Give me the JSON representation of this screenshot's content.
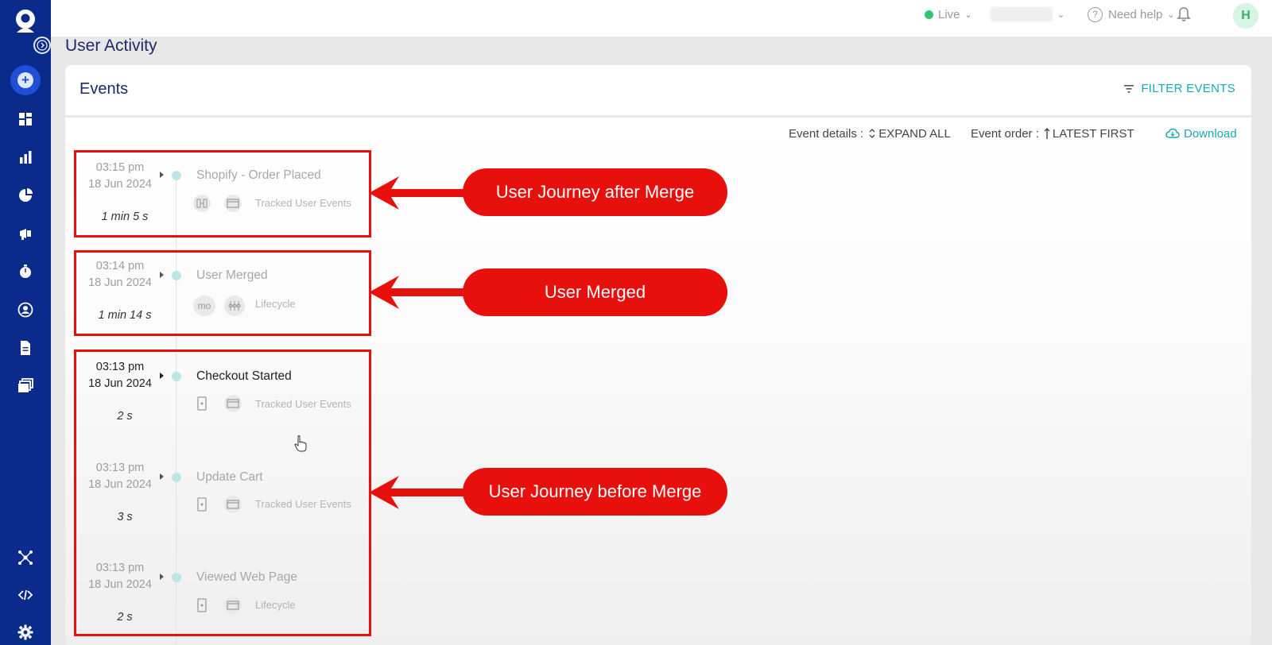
{
  "topbar": {
    "live_label": "Live",
    "need_help_label": "Need help",
    "avatar_initial": "H"
  },
  "page_title": "User Activity",
  "card": {
    "title": "Events",
    "filter_label": "FILTER EVENTS",
    "event_details_label": "Event details :",
    "expand_all_label": "EXPAND ALL",
    "event_order_label": "Event order :",
    "latest_first_label": "LATEST FIRST",
    "download_label": "Download"
  },
  "events": [
    {
      "time": "03:15 pm",
      "date": "18 Jun 2024",
      "duration": "1 min 5 s",
      "name": "Shopify - Order Placed",
      "category": "Tracked User Events"
    },
    {
      "time": "03:14 pm",
      "date": "18 Jun 2024",
      "duration": "1 min 14 s",
      "name": "User Merged",
      "chip_text": "mo",
      "category": "Lifecycle"
    },
    {
      "time": "03:13 pm",
      "date": "18 Jun 2024",
      "duration": "2 s",
      "name": "Checkout Started",
      "category": "Tracked User Events"
    },
    {
      "time": "03:13 pm",
      "date": "18 Jun 2024",
      "duration": "3 s",
      "name": "Update Cart",
      "category": "Tracked User Events"
    },
    {
      "time": "03:13 pm",
      "date": "18 Jun 2024",
      "duration": "2 s",
      "name": "Viewed Web Page",
      "category": "Lifecycle"
    }
  ],
  "annotations": [
    {
      "label": "User Journey after Merge"
    },
    {
      "label": "User Merged"
    },
    {
      "label": "User Journey before Merge"
    }
  ],
  "colors": {
    "sidebar": "#0a2a8c",
    "accent_teal": "#1aa7b8",
    "annotation_red": "#e8100c",
    "live_green": "#35c46f"
  }
}
